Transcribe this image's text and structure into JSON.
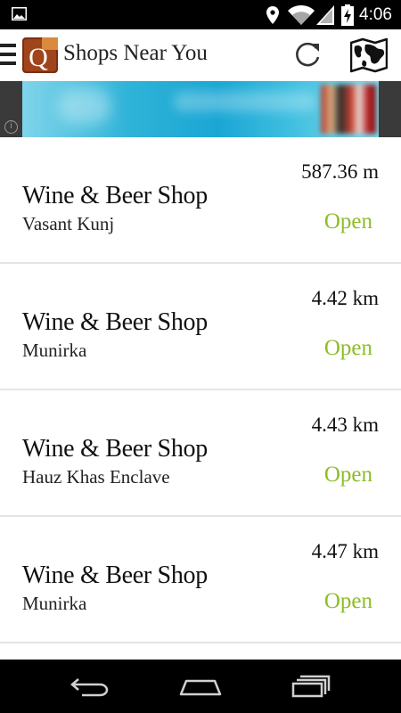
{
  "status_bar": {
    "time": "4:06",
    "icons": [
      "image-icon",
      "location-icon",
      "wifi-icon",
      "signal-icon",
      "battery-charging-icon"
    ]
  },
  "header": {
    "title": "Shops Near You",
    "logo_letter": "Q",
    "icons": [
      "menu-icon",
      "app-logo",
      "refresh-icon",
      "map-icon"
    ]
  },
  "ad": {
    "icon": "info-icon",
    "info_glyph": "i"
  },
  "shops": [
    {
      "name": "Wine & Beer Shop",
      "area": "Vasant Kunj",
      "distance": "587.36 m",
      "status": "Open"
    },
    {
      "name": "Wine & Beer Shop",
      "area": "Munirka",
      "distance": "4.42 km",
      "status": "Open"
    },
    {
      "name": "Wine & Beer Shop",
      "area": "Hauz Khas Enclave",
      "distance": "4.43 km",
      "status": "Open"
    },
    {
      "name": "Wine & Beer Shop",
      "area": "Munirka",
      "distance": "4.47 km",
      "status": "Open"
    }
  ],
  "nav_bar": {
    "icons": [
      "back-icon",
      "home-icon",
      "recent-apps-icon"
    ]
  },
  "colors": {
    "open_status": "#8cbd26",
    "status_bar": "#000000",
    "nav_bar": "#000000",
    "divider": "#e4e4e4"
  }
}
